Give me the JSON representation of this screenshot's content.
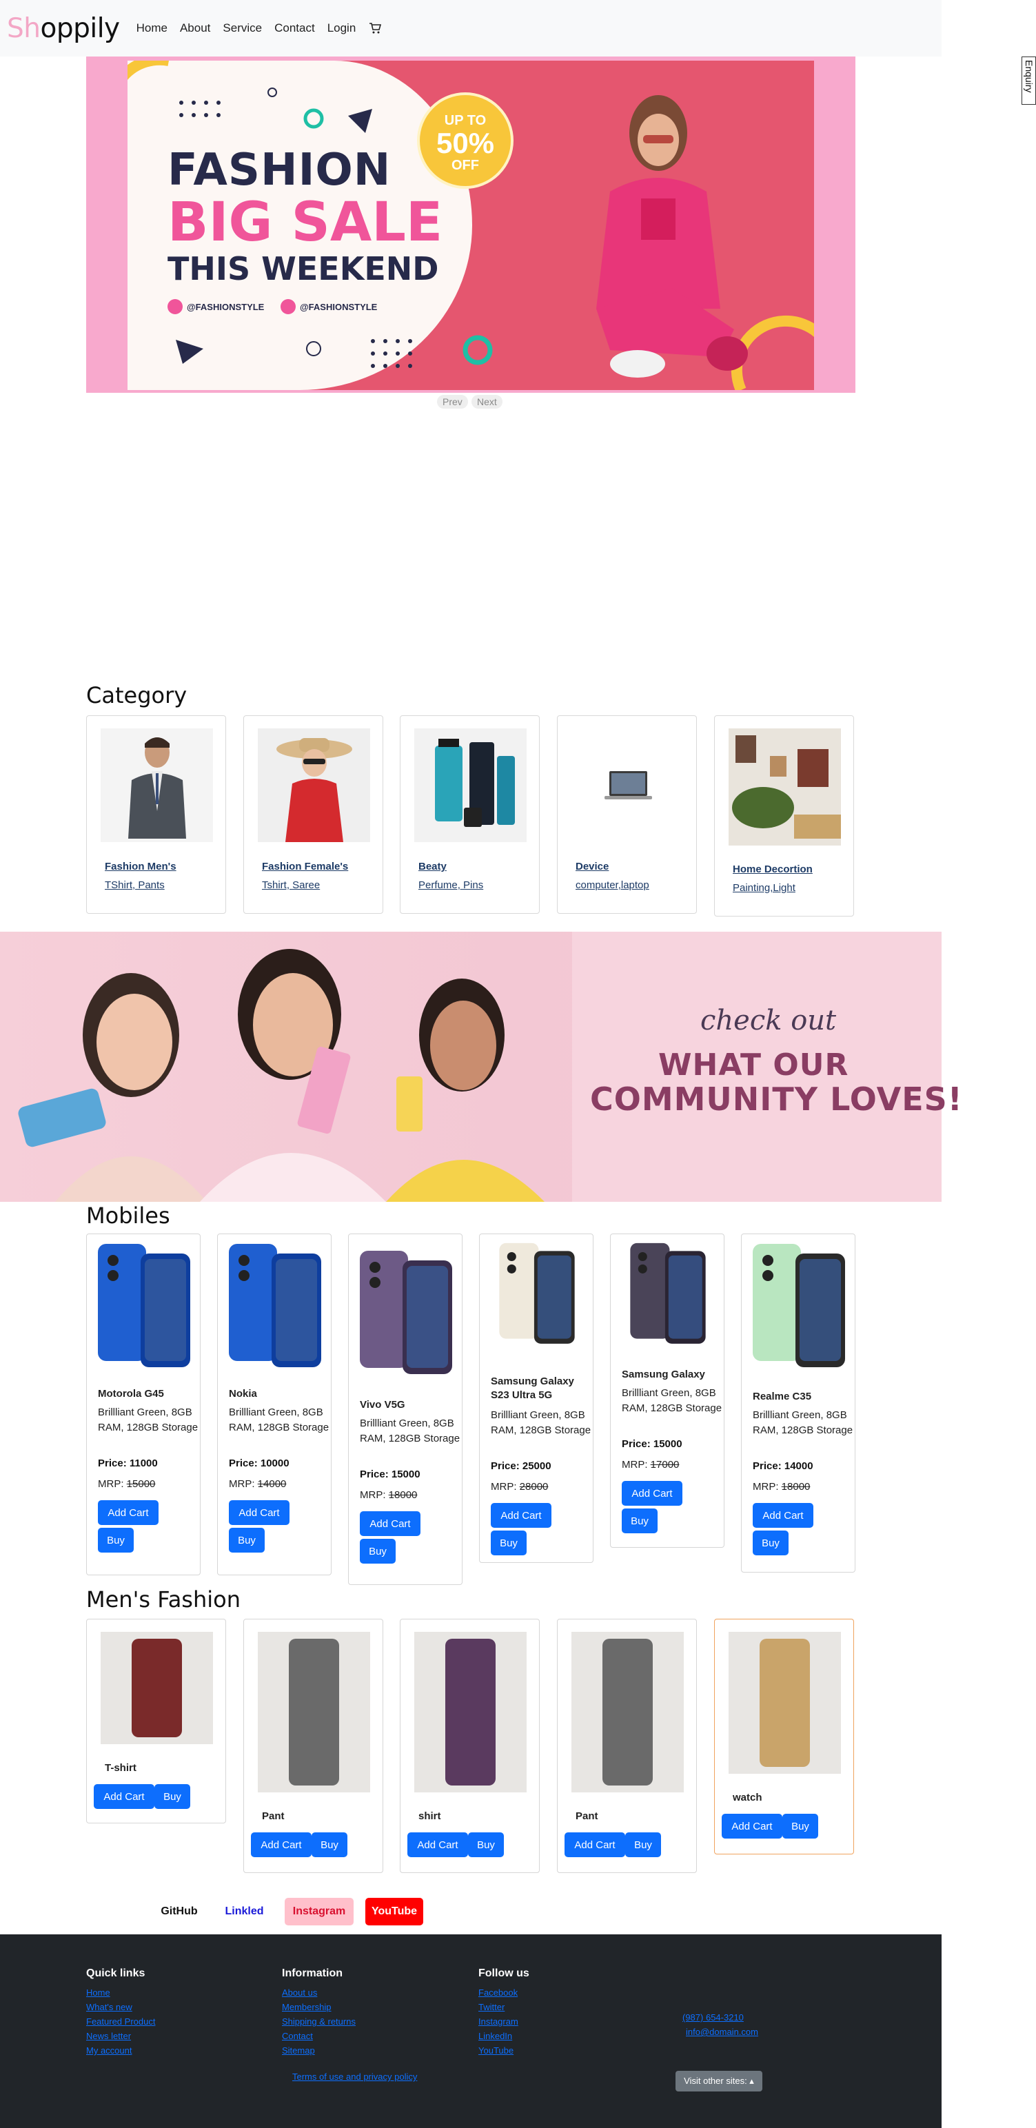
{
  "nav": {
    "brand_first": "Sh",
    "brand_rest": "oppily",
    "links": [
      "Home",
      "About",
      "Service",
      "Contact",
      "Login"
    ],
    "cart_icon": "cart-icon"
  },
  "enquiry": "Enquiry",
  "hero": {
    "line1": "FASHION",
    "line2": "BIG SALE",
    "line3": "THIS WEEKEND",
    "badge_up": "UP TO",
    "badge_pct": "50%",
    "badge_off": "OFF",
    "social1": "@FASHIONSTYLE",
    "social2": "@FASHIONSTYLE",
    "prev": "Prev",
    "next": "Next"
  },
  "category": {
    "title": "Category",
    "items": [
      {
        "title": "Fashion Men's",
        "sub": "TShirt, Pants"
      },
      {
        "title": "Fashion Female's",
        "sub": "Tshirt, Saree"
      },
      {
        "title": "Beaty",
        "sub": "Perfume, Pins"
      },
      {
        "title": "Device",
        "sub": "computer,laptop"
      },
      {
        "title": "Home Decortion",
        "sub": "Painting,Light"
      }
    ]
  },
  "banner": {
    "script": "check out",
    "line1": "WHAT OUR",
    "line2": "COMMUNITY LOVES!"
  },
  "mobiles": {
    "title": "Mobiles",
    "price_label": "Price: ",
    "mrp_label": "MRP: ",
    "add_label": "Add Cart",
    "buy_label": "Buy",
    "items": [
      {
        "name": "Motorola G45",
        "desc": "Brillliant Green, 8GB RAM, 128GB Storage",
        "price": "11000",
        "mrp": "15000"
      },
      {
        "name": "Nokia",
        "desc": "Brillliant Green, 8GB RAM, 128GB Storage",
        "price": "10000",
        "mrp": "14000"
      },
      {
        "name": "Vivo V5G",
        "desc": "Brillliant Green, 8GB RAM, 128GB Storage",
        "price": "15000",
        "mrp": "18000"
      },
      {
        "name": "Samsung Galaxy S23 Ultra 5G",
        "desc": "Brillliant Green, 8GB RAM, 128GB Storage",
        "price": "25000",
        "mrp": "28000"
      },
      {
        "name": "Samsung Galaxy",
        "desc": "Brillliant Green, 8GB RAM, 128GB Storage",
        "price": "15000",
        "mrp": "17000"
      },
      {
        "name": "Realme C35",
        "desc": "Brillliant Green, 8GB RAM, 128GB Storage",
        "price": "14000",
        "mrp": "18000"
      }
    ]
  },
  "mens": {
    "title": "Men's Fashion",
    "add_label": "Add Cart",
    "buy_label": "Buy",
    "items": [
      "T-shirt",
      "Pant",
      "shirt",
      "Pant",
      "watch"
    ]
  },
  "social": [
    "GitHub",
    "Linkled",
    "Instagram",
    "YouTube"
  ],
  "footer": {
    "col1": {
      "title": "Quick links",
      "links": [
        "Home",
        "What's new",
        "Featured Product",
        "News letter",
        "My account"
      ]
    },
    "col2": {
      "title": "Information",
      "links": [
        "About us",
        "Membership",
        "Shipping & returns",
        "Contact",
        "Sitemap"
      ]
    },
    "col3": {
      "title": "Follow us",
      "links": [
        "Facebook",
        "Twitter",
        "Instagram",
        "LinkedIn",
        "YouTube"
      ]
    },
    "phone": "(987) 654-3210",
    "email": "info@domain.com",
    "terms": "Terms of use and privacy policy",
    "visit": "Visit other sites: ▴"
  },
  "colors": {
    "primary": "#0d6efd",
    "brand_pink": "#f3a7c6",
    "footer_bg": "#212529",
    "instagram_bg": "#ffc0cb",
    "youtube_bg": "#ff0000"
  }
}
